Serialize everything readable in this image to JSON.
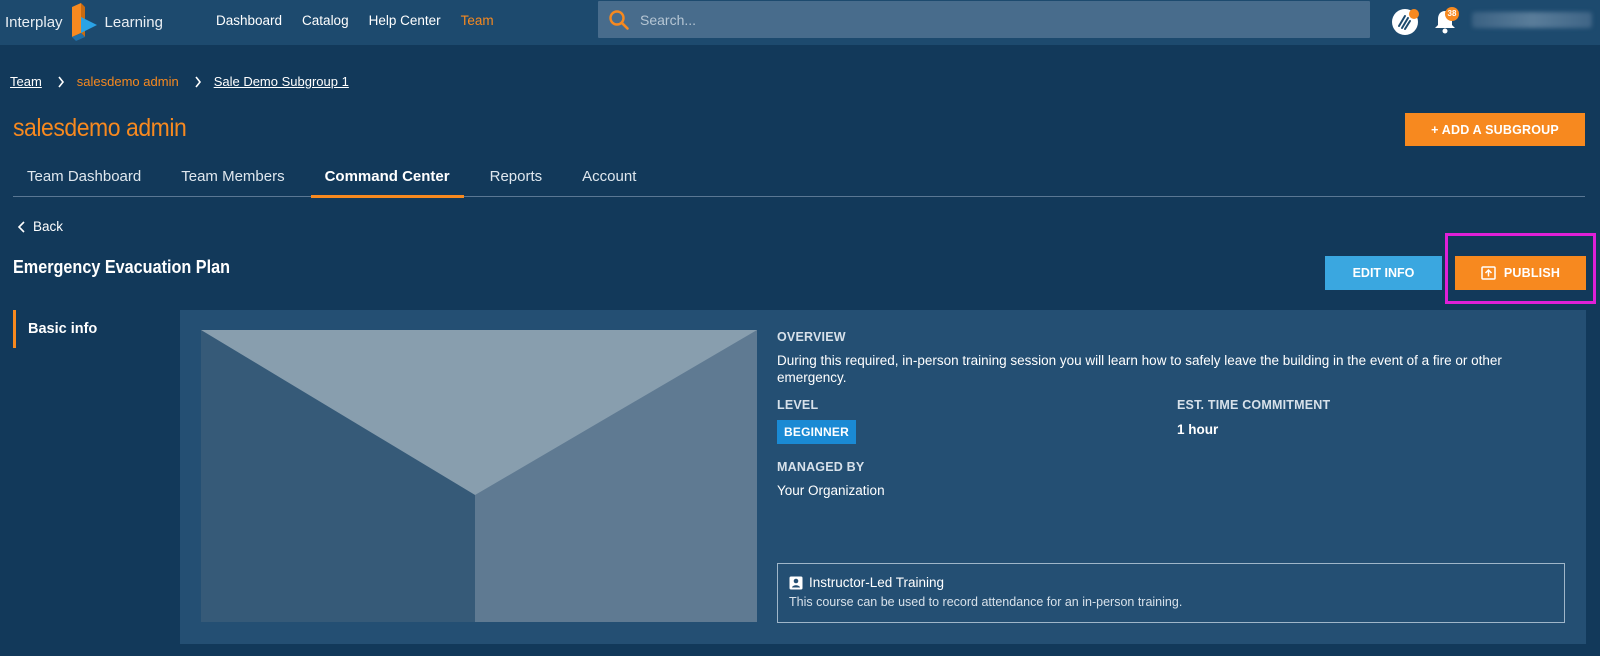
{
  "brand": {
    "word_left": "Interplay",
    "word_right": "Learning"
  },
  "nav": {
    "links": [
      {
        "label": "Dashboard",
        "active": false
      },
      {
        "label": "Catalog",
        "active": false
      },
      {
        "label": "Help Center",
        "active": false
      },
      {
        "label": "Team",
        "active": true
      }
    ],
    "search_placeholder": "Search...",
    "notification_count": "38"
  },
  "breadcrumb": {
    "items": [
      {
        "label": "Team"
      },
      {
        "label": "salesdemo admin"
      },
      {
        "label": "Sale Demo Subgroup 1"
      }
    ]
  },
  "page": {
    "title": "salesdemo admin",
    "add_subgroup_label": "+ ADD A SUBGROUP"
  },
  "tabs": [
    {
      "label": "Team Dashboard",
      "active": false
    },
    {
      "label": "Team Members",
      "active": false
    },
    {
      "label": "Command Center",
      "active": true
    },
    {
      "label": "Reports",
      "active": false
    },
    {
      "label": "Account",
      "active": false
    }
  ],
  "course": {
    "back_label": "Back",
    "title": "Emergency Evacuation Plan",
    "edit_label": "EDIT INFO",
    "publish_label": "PUBLISH",
    "side_nav_label": "Basic info",
    "overview_label": "OVERVIEW",
    "overview_text": "During this required, in-person training session you will learn how to safely leave the building in the event of a fire or other emergency.",
    "level_label": "LEVEL",
    "level_value": "BEGINNER",
    "time_label": "EST. TIME COMMITMENT",
    "time_value": "1 hour",
    "managed_label": "MANAGED BY",
    "managed_value": "Your Organization",
    "ilt_title": "Instructor-Led Training",
    "ilt_desc": "This course can be used to record attendance for an in-person training."
  },
  "colors": {
    "accent": "#f7891f",
    "info_blue": "#3aa7e0",
    "background": "#12395a",
    "highlight": "#e020d8"
  },
  "icons": [
    "search-icon",
    "hand-wave-icon",
    "bell-icon",
    "chevron-right-icon",
    "chevron-left-icon",
    "upload-icon",
    "id-badge-icon",
    "image-placeholder"
  ]
}
